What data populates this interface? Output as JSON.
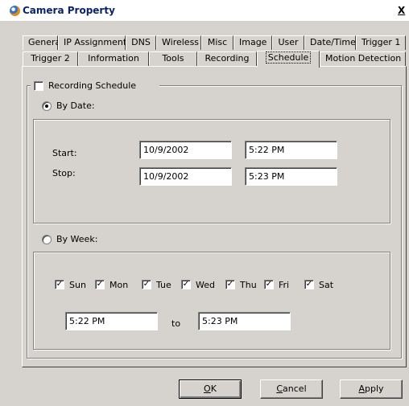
{
  "window": {
    "title": "Camera Property",
    "close_label": "X"
  },
  "tabs": {
    "row1": [
      "General",
      "IP Assignment",
      "DNS",
      "Wireless",
      "Misc",
      "Image",
      "User",
      "Date/Time",
      "Trigger 1"
    ],
    "row2": [
      "Trigger 2",
      "Information",
      "Tools",
      "Recording",
      "Schedule",
      "Motion Detection"
    ],
    "active": "Schedule"
  },
  "schedule": {
    "enable_label": "Recording Schedule",
    "enabled": false,
    "by_date": {
      "label": "By Date:",
      "selected": true,
      "start_label": "Start:",
      "stop_label": "Stop:",
      "start_date": "10/9/2002",
      "start_time": "5:22 PM",
      "stop_date": "10/9/2002",
      "stop_time": "5:23 PM"
    },
    "by_week": {
      "label": "By Week:",
      "selected": false,
      "days": [
        {
          "label": "Sun",
          "checked": true
        },
        {
          "label": "Mon",
          "checked": true
        },
        {
          "label": "Tue",
          "checked": true
        },
        {
          "label": "Wed",
          "checked": true
        },
        {
          "label": "Thu",
          "checked": true
        },
        {
          "label": "Fri",
          "checked": true
        },
        {
          "label": "Sat",
          "checked": true
        }
      ],
      "from_time": "5:22 PM",
      "to_label": "to",
      "to_time": "5:23 PM"
    }
  },
  "buttons": {
    "ok": {
      "prefix": "",
      "mnemonic": "O",
      "suffix": "K"
    },
    "cancel": {
      "prefix": "",
      "mnemonic": "C",
      "suffix": "ancel"
    },
    "apply": {
      "prefix": "",
      "mnemonic": "A",
      "suffix": "pply"
    }
  }
}
